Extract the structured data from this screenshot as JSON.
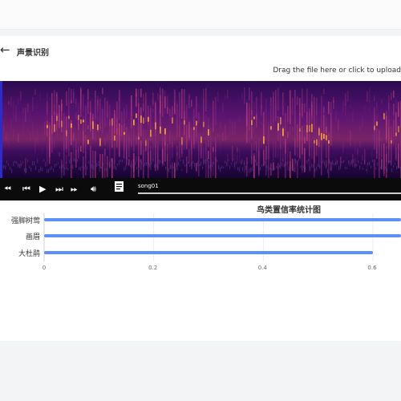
{
  "page": {
    "title": "声景识别",
    "upload_hint": "Drag the file here or click to upload"
  },
  "player": {
    "controls": [
      "skip-back",
      "previous",
      "play",
      "next",
      "skip-forward",
      "volume",
      "download"
    ],
    "track_name": "song01",
    "progress": 0.0
  },
  "colors": {
    "bar": "#5b8ff9",
    "spectrogram_background": "#1a0636",
    "spectrogram_hot": "#f7a23c"
  },
  "chart_data": {
    "type": "bar",
    "orientation": "horizontal",
    "title": "鸟类置信率统计图",
    "categories": [
      "强脚树莺",
      "画眉",
      "大杜鹃"
    ],
    "values": [
      0.95,
      0.95,
      0.6
    ],
    "xlim": [
      0,
      0.65
    ],
    "xticks": [
      "0",
      "0.2",
      "0.4",
      "0.6"
    ],
    "xtick_values": [
      0,
      0.2,
      0.4,
      0.6
    ],
    "grid": true,
    "legend": "none"
  }
}
